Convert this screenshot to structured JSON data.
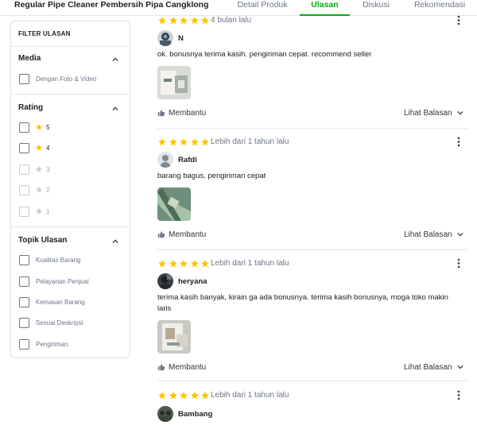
{
  "product_title": "Regular Pipe Cleaner Pembersih Pipa Cangklong",
  "tabs": [
    "Detail Produk",
    "Ulasan",
    "Diskusi",
    "Rekomendasi"
  ],
  "active_tab": "Ulasan",
  "filter": {
    "heading": "FILTER ULASAN",
    "media": {
      "title": "Media",
      "options": [
        "Dengan Foto & Video"
      ]
    },
    "rating": {
      "title": "Rating",
      "options": [
        "5",
        "4",
        "3",
        "2",
        "1"
      ]
    },
    "topics": {
      "title": "Topik Ulasan",
      "options": [
        "Kualitas Barang",
        "Pelayanan Penjual",
        "Kemasan Barang",
        "Sesuai Deskripsi",
        "Pengiriman"
      ]
    }
  },
  "colors": {
    "accent": "#03ac0e",
    "star": "#ffc400",
    "star_disabled": "#c7cdd5"
  },
  "reviews": [
    {
      "rating": 5,
      "time": "4 bulan lalu",
      "user": "N",
      "text": "ok. bonusnya terima kasih. pengiriman cepat. recommend seller",
      "helpful_label": "Membantu",
      "replies_label": "Lihat Balasan"
    },
    {
      "rating": 5,
      "time": "Lebih dari 1 tahun lalu",
      "user": "Rafdi",
      "text": "barang bagus, pengiriman cepat",
      "helpful_label": "Membantu",
      "replies_label": "Lihat Balasan"
    },
    {
      "rating": 5,
      "time": "Lebih dari 1 tahun lalu",
      "user": "heryana",
      "text": "terima kasih banyak, kirain ga ada bonusnya. terima kasih bonusnya, moga toko makin laris",
      "helpful_label": "Membantu",
      "replies_label": "Lihat Balasan"
    },
    {
      "rating": 5,
      "time": "Lebih dari 1 tahun lalu",
      "user": "Bambang"
    }
  ],
  "icons": {
    "star": "star-icon",
    "chevron_up": "chevron-up-icon",
    "chevron_down": "chevron-down-icon",
    "kebab": "more-vertical-icon",
    "thumbs_up": "thumbs-up-icon"
  }
}
